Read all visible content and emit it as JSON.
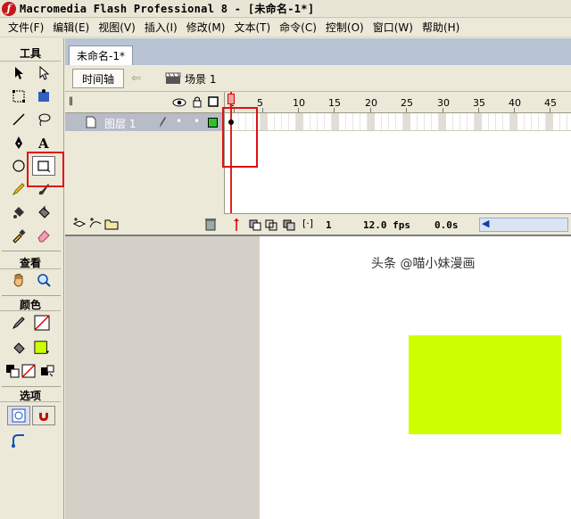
{
  "window": {
    "title": "Macromedia Flash Professional 8 - [未命名-1*]"
  },
  "menu": [
    "文件(F)",
    "编辑(E)",
    "视图(V)",
    "插入(I)",
    "修改(M)",
    "文本(T)",
    "命令(C)",
    "控制(O)",
    "窗口(W)",
    "帮助(H)"
  ],
  "tools": {
    "header": "工具",
    "view_header": "查看",
    "color_header": "颜色",
    "options_header": "选项"
  },
  "document": {
    "tab": "未命名-1*",
    "timeline_button": "时间轴",
    "scene_label": "场景 1"
  },
  "timeline": {
    "ruler_numbers": [
      "1",
      "5",
      "10",
      "15",
      "20",
      "25",
      "30",
      "35",
      "40",
      "45"
    ],
    "layer_name": "图层 1",
    "current_frame": "1",
    "frame_rate": "12.0 fps",
    "elapsed_time": "0.0s"
  },
  "colors": {
    "fill": "#ccff00",
    "highlight": "#e01010"
  },
  "watermark": "头条 @喵小妹漫画"
}
